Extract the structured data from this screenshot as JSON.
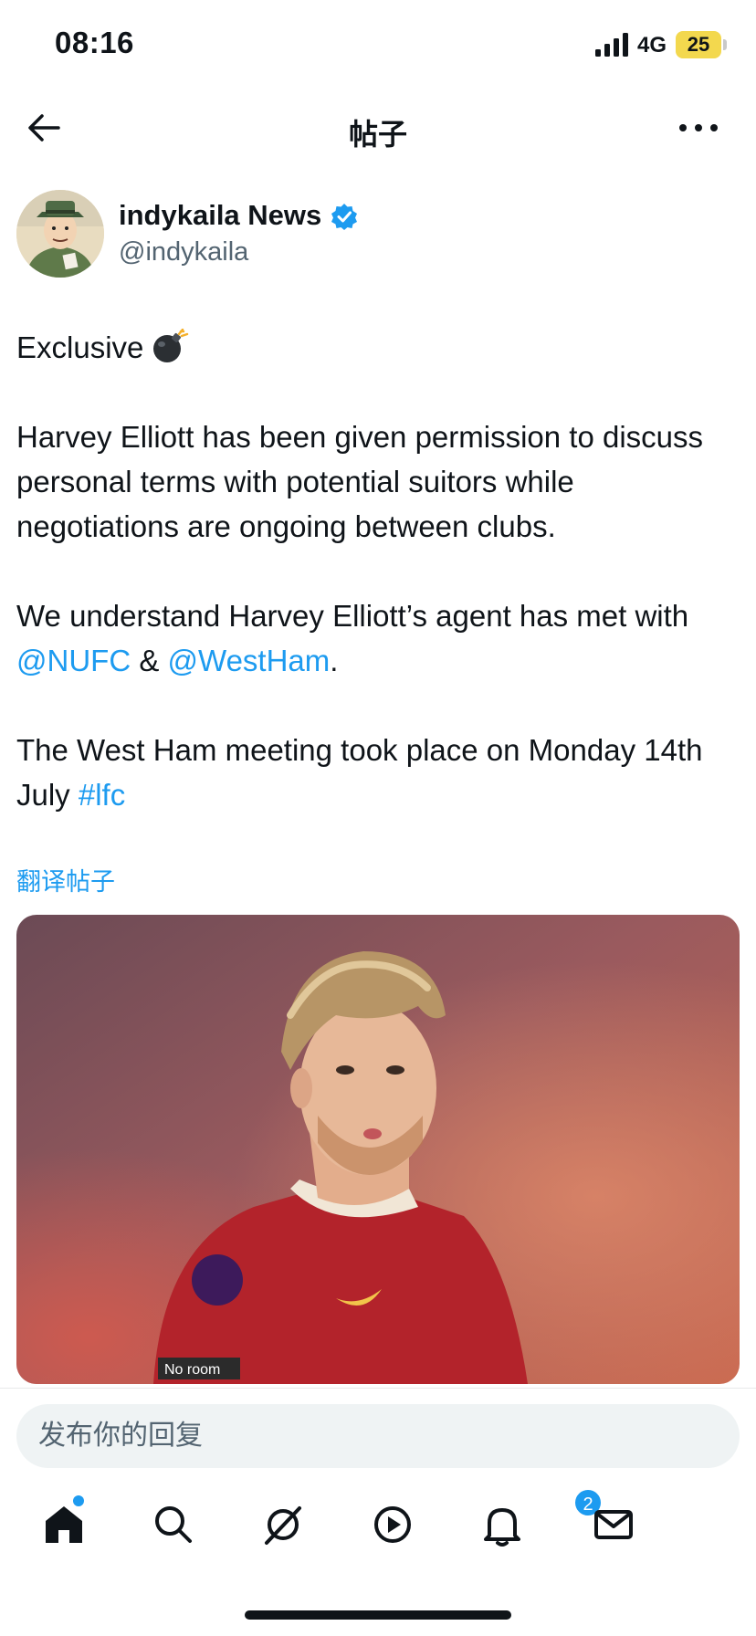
{
  "status_bar": {
    "time": "08:16",
    "network": "4G",
    "battery": "25"
  },
  "nav": {
    "title": "帖子"
  },
  "author": {
    "display_name": "indykaila News",
    "handle": "@indykaila"
  },
  "tweet": {
    "line1": "Exclusive",
    "p2": "Harvey Elliott has been given permission to discuss personal terms with potential suitors while negotiations are ongoing between clubs.",
    "p3_pre": "We understand Harvey Elliott’s agent has met with ",
    "mention1": "@NUFC",
    "p3_mid": " & ",
    "mention2": "@WestHam",
    "p3_end": ".",
    "p4_pre": "The West Ham meeting took place on Monday 14th July ",
    "hashtag": "#lfc"
  },
  "translate_label": "翻译帖子",
  "reply": {
    "placeholder": "发布你的回复"
  },
  "tabs": {
    "notification_count": "2"
  },
  "media_badge_text": "No room",
  "colors": {
    "accent": "#1d9bf0",
    "text": "#0f1419",
    "secondary": "#536471"
  },
  "icons": [
    "back-arrow-icon",
    "more-icon",
    "verified-icon",
    "bomb-icon",
    "home-icon",
    "search-icon",
    "grok-icon",
    "video-icon",
    "bell-icon",
    "mail-icon"
  ]
}
